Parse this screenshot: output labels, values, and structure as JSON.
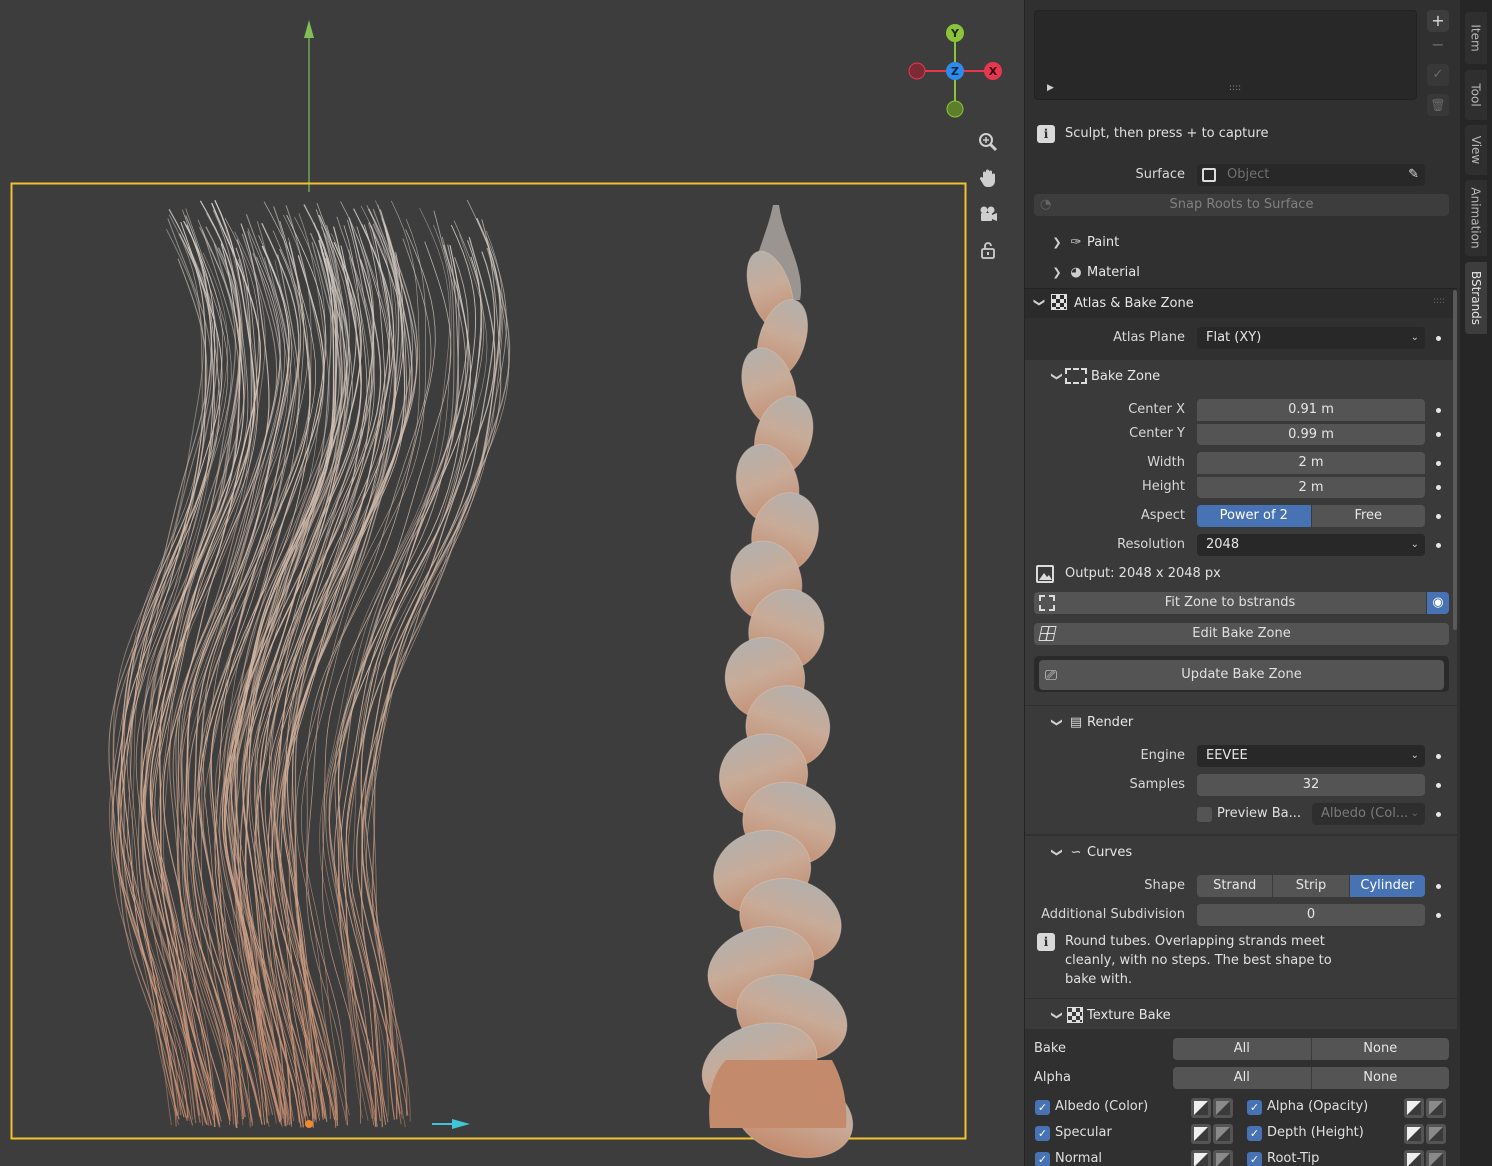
{
  "viewport": {
    "navigation_gizmo": {
      "y": "Y",
      "z": "Z",
      "x": "X"
    }
  },
  "sidebar": {
    "capture_hint": "Sculpt, then press + to capture",
    "surface": {
      "label": "Surface",
      "placeholder": "Object"
    },
    "snap_roots_label": "Snap Roots to Surface",
    "paint_label": "Paint",
    "material_label": "Material",
    "atlas_bake": {
      "title": "Atlas & Bake Zone",
      "atlas_plane_label": "Atlas Plane",
      "atlas_plane_value": "Flat (XY)",
      "bake_zone": {
        "title": "Bake Zone",
        "center_x_label": "Center X",
        "center_x_value": "0.91 m",
        "center_y_label": "Center Y",
        "center_y_value": "0.99 m",
        "width_label": "Width",
        "width_value": "2 m",
        "height_label": "Height",
        "height_value": "2 m",
        "aspect_label": "Aspect",
        "aspect_options": [
          "Power of 2",
          "Free"
        ],
        "aspect_selected": "Power of 2",
        "resolution_label": "Resolution",
        "resolution_value": "2048",
        "output_text": "Output: 2048 x 2048 px",
        "fit_zone_label": "Fit Zone to bstrands",
        "edit_zone_label": "Edit Bake Zone",
        "update_zone_label": "Update Bake Zone"
      },
      "render": {
        "title": "Render",
        "engine_label": "Engine",
        "engine_value": "EEVEE",
        "samples_label": "Samples",
        "samples_value": "32",
        "preview_label": "Preview Ba...",
        "preview_pass": "Albedo (Col..."
      },
      "curves": {
        "title": "Curves",
        "shape_label": "Shape",
        "shape_options": [
          "Strand",
          "Strip",
          "Cylinder"
        ],
        "shape_selected": "Cylinder",
        "subdivision_label": "Additional Subdivision",
        "subdivision_value": "0",
        "info_lines": [
          "Round tubes. Overlapping strands meet",
          "cleanly, with no steps. The best shape to",
          "bake with."
        ]
      },
      "texture_bake": {
        "title": "Texture Bake",
        "bake_label": "Bake",
        "alpha_label": "Alpha",
        "all_label": "All",
        "none_label": "None",
        "passes_left": [
          "Albedo (Color)",
          "Specular",
          "Normal"
        ],
        "passes_right": [
          "Alpha (Opacity)",
          "Depth (Height)",
          "Root-Tip"
        ]
      }
    }
  },
  "tabs": [
    "Item",
    "Tool",
    "View",
    "Animation",
    "BStrands"
  ],
  "active_tab": "BStrands",
  "colors": {
    "accent": "#4772b3",
    "selection_outline": "#f2c12e",
    "axis_x": "#e8364f",
    "axis_y": "#8bc43a",
    "axis_z": "#2d8ceb"
  }
}
